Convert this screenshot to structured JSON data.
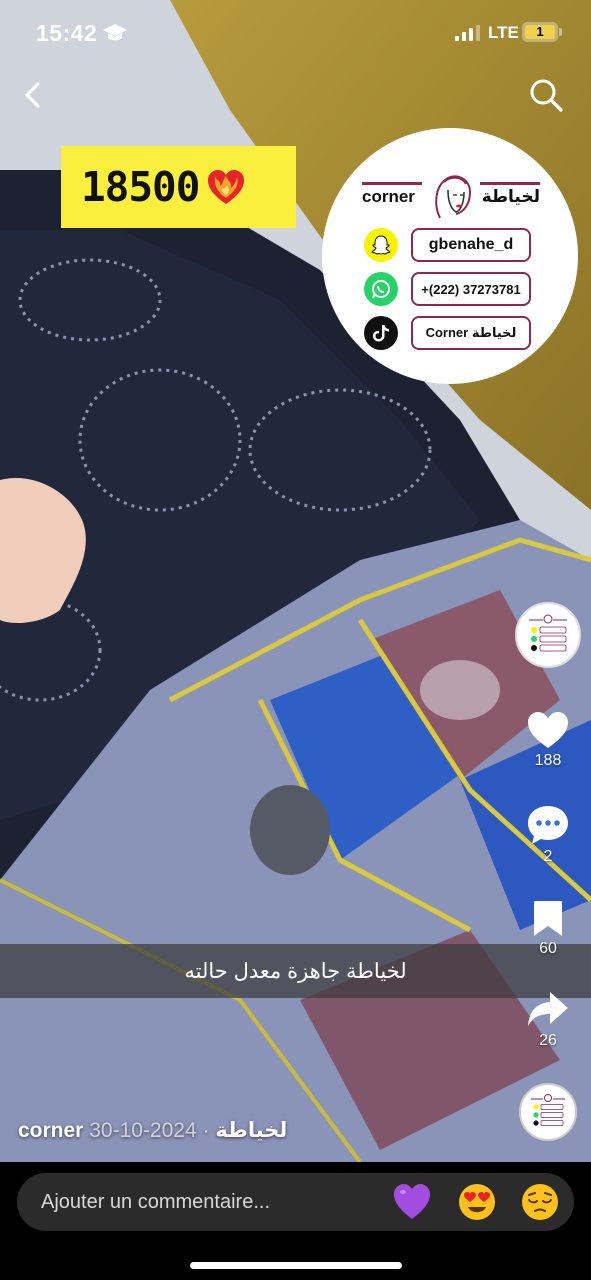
{
  "status_bar": {
    "time": "15:42",
    "network": "LTE",
    "battery": "1"
  },
  "nav": {
    "back_icon": "chevron-left-icon",
    "search_icon": "search-icon"
  },
  "overlay": {
    "price": "18500",
    "price_emoji": "heart-on-fire",
    "brand_latin": "corner",
    "brand_arabic": "لخياطة",
    "contacts": [
      {
        "icon": "snapchat-icon",
        "value": "gbenahe_d"
      },
      {
        "icon": "whatsapp-icon",
        "value": "+(222) 37273781"
      },
      {
        "icon": "tiktok-icon",
        "value": "Corner لخياطة"
      }
    ],
    "caption": "لخياطة جاهزة معدل حالته"
  },
  "actions": {
    "likes": "188",
    "comments": "2",
    "saves": "60",
    "shares": "26"
  },
  "post": {
    "author": "corner لخياطة",
    "separator": " · ",
    "date": "2024-10-30"
  },
  "comment_bar": {
    "placeholder": "Ajouter un commentaire...",
    "emojis": [
      "purple-heart",
      "heart-eyes",
      "pensive-face"
    ]
  },
  "colors": {
    "price_bg": "#fbef3e",
    "brand_accent": "#8b2a4a",
    "bar_bg": "#2b2b2b"
  }
}
